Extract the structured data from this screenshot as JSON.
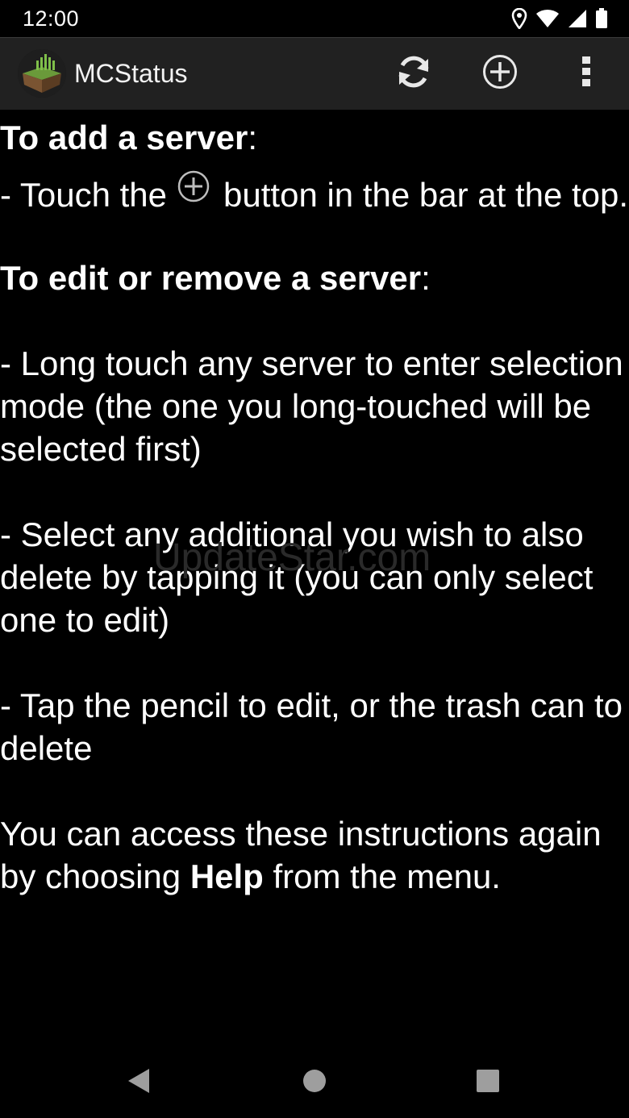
{
  "status_bar": {
    "time": "12:00",
    "icons": [
      "location-icon",
      "wifi-icon",
      "signal-icon",
      "battery-icon"
    ]
  },
  "app_bar": {
    "title": "MCStatus",
    "actions": [
      "refresh-icon",
      "add-circle-icon",
      "overflow-menu-icon"
    ],
    "background": "#212121"
  },
  "content": {
    "add_heading": "To add a server",
    "add_heading_colon": ":",
    "add_step_part1": "- Touch the",
    "add_step_part2": "button in the bar at the top.",
    "edit_heading": "To edit or remove a server",
    "edit_heading_colon": ":",
    "edit_step1": "- Long touch any server to enter selection mode (the one you long-touched will be selected first)",
    "edit_step2": "- Select any additional you wish to also delete by tapping it (you can only select one to edit)",
    "edit_step3": "- Tap the pencil to edit, or the trash can to delete",
    "footer_part1": "You can access these instructions again by choosing ",
    "footer_bold": "Help",
    "footer_part2": " from the menu."
  },
  "watermark": "UpdateStar.com",
  "nav_bar": {
    "icons": [
      "back-icon",
      "home-icon",
      "recents-icon"
    ]
  }
}
